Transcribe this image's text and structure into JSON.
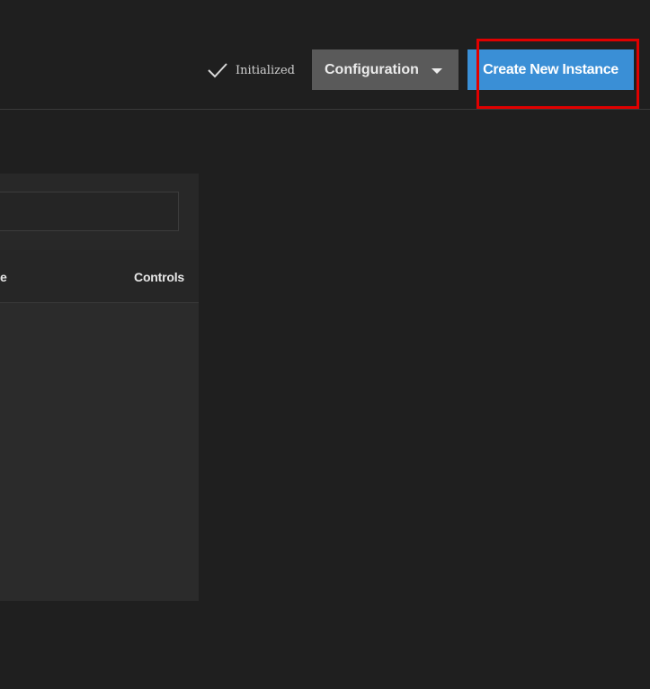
{
  "header": {
    "status": {
      "icon": "check-icon",
      "label": "Initialized"
    },
    "configuration_button": {
      "label": "Configuration",
      "icon": "caret-down-icon"
    },
    "create_button": {
      "label": "Create New Instance"
    }
  },
  "instances_table": {
    "search": {
      "value": "",
      "placeholder": ""
    },
    "columns": [
      "e",
      "Controls"
    ],
    "rows": []
  },
  "colors": {
    "background": "#1f1f1f",
    "panel": "#2a2a2a",
    "primary_button": "#3a8fd6",
    "secondary_button": "#5a5a5a",
    "highlight": "#e00000"
  }
}
